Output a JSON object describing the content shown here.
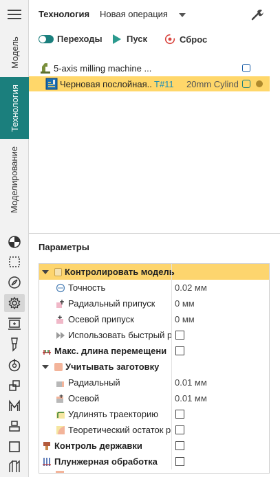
{
  "sidebar": {
    "tabs": [
      {
        "label": "Модель",
        "active": false
      },
      {
        "label": "Технология",
        "active": true
      },
      {
        "label": "Моделирование",
        "active": false
      }
    ],
    "tools": [
      "pie-chart-icon",
      "dotted-selection-icon",
      "compass-icon",
      "gear-icon",
      "resize-frame-icon",
      "brush-icon",
      "target-icon",
      "clone-icon",
      "machine-m-icon",
      "stack-icon",
      "square-icon",
      "columns-icon"
    ]
  },
  "header": {
    "title": "Технология",
    "operation_select": "Новая операция"
  },
  "actions": {
    "transitions_label": "Переходы",
    "start_label": "Пуск",
    "reset_label": "Сброс"
  },
  "tree": {
    "machine": "5-axis milling machine ...",
    "operation": {
      "name": "Черновая послойная...",
      "tool": "T#11",
      "tool_desc": "20mm Cylind"
    }
  },
  "params": {
    "title": "Параметры",
    "rows": [
      {
        "name": "Контролировать модель",
        "value": ""
      },
      {
        "name": "Точность",
        "value": "0.02 мм"
      },
      {
        "name": "Радиальный припуск",
        "value": "0 мм"
      },
      {
        "name": "Осевой припуск",
        "value": "0 мм"
      },
      {
        "name": "Использовать быстрый р",
        "value": ""
      },
      {
        "name": "Макс. длина перемещени",
        "value": ""
      },
      {
        "name": "Учитывать заготовку",
        "value": ""
      },
      {
        "name": "Радиальный",
        "value": "0.01 мм"
      },
      {
        "name": "Осевой",
        "value": "0.01 мм"
      },
      {
        "name": "Удлинять траекторию",
        "value": ""
      },
      {
        "name": "Теоретический остаток р",
        "value": ""
      },
      {
        "name": "Контроль державки",
        "value": ""
      },
      {
        "name": "Плунжерная обработка",
        "value": ""
      }
    ]
  },
  "colors": {
    "accent": "#1b7f7d",
    "highlight": "#ffd76a",
    "reset_red": "#d9453f",
    "tool_blue": "#1a8bb5"
  }
}
